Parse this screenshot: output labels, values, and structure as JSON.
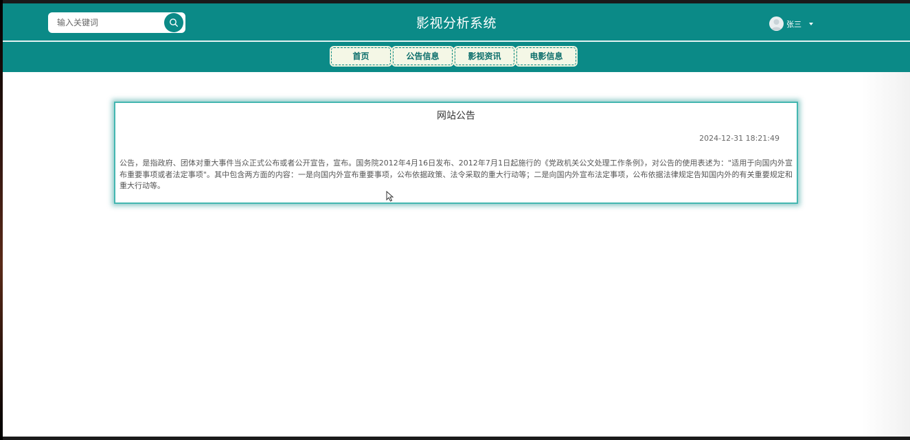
{
  "header": {
    "title": "影视分析系统",
    "search": {
      "placeholder": "输入关键词",
      "value": "",
      "button_icon": "search-icon"
    },
    "user": {
      "name": "张三",
      "avatar_icon": "user-avatar-icon",
      "dropdown_icon": "caret-down-icon"
    }
  },
  "nav": {
    "items": [
      {
        "label": "首页"
      },
      {
        "label": "公告信息"
      },
      {
        "label": "影视资讯"
      },
      {
        "label": "电影信息"
      }
    ]
  },
  "notice": {
    "title": "网站公告",
    "time": "2024-12-31 18:21:49",
    "content": "公告，是指政府、团体对重大事件当众正式公布或者公开宣告，宣布。国务院2012年4月16日发布、2012年7月1日起施行的《党政机关公文处理工作条例》，对公告的使用表述为：\"适用于向国内外宣布重要事项或者法定事项\"。其中包含两方面的内容：一是向国内外宣布重要事项，公布依据政策、法令采取的重大行动等；二是向国内外宣布法定事项，公布依据法律规定告知国内外的有关重要规定和重大行动等。"
  },
  "colors": {
    "primary": "#0b8a87",
    "nav_button_bg": "#f4f7e6",
    "card_border": "#43b6b0"
  }
}
